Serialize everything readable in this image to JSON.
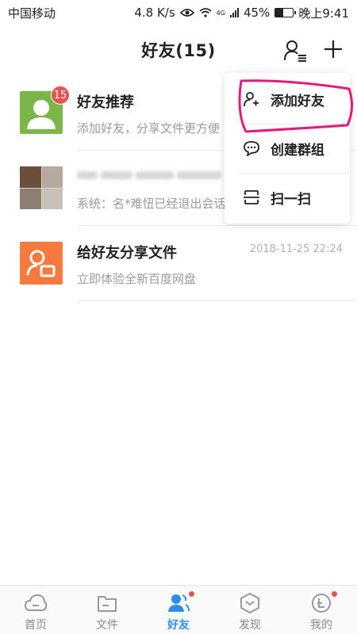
{
  "status_bar": {
    "carrier": "中国移动",
    "speed": "4.8 K/s",
    "network": "4G",
    "battery": "45%",
    "battery_level": 0.45,
    "time": "晚上9:41"
  },
  "header": {
    "title": "好友(15)",
    "contacts_icon": "contacts-list-icon",
    "add_icon": "plus-icon"
  },
  "list": [
    {
      "title": "好友推荐",
      "subtitle": "添加好友，分享文件更方便",
      "badge": "15",
      "time": ""
    },
    {
      "title": "",
      "subtitle": "系统：名*难忸已经退出会话",
      "time": ""
    },
    {
      "title": "给好友分享文件",
      "subtitle": "立即体验全新百度网盘",
      "time": "2018-11-25 22:24"
    }
  ],
  "popup_menu": {
    "items": [
      {
        "label": "添加好友",
        "icon": "add-user-icon"
      },
      {
        "label": "创建群组",
        "icon": "chat-bubble-icon"
      },
      {
        "label": "扫一扫",
        "icon": "scan-icon"
      }
    ],
    "highlight_color": "#e8197d"
  },
  "bottom_nav": {
    "items": [
      {
        "label": "首页",
        "icon": "cloud-home-icon"
      },
      {
        "label": "文件",
        "icon": "folder-icon"
      },
      {
        "label": "好友",
        "icon": "friends-icon"
      },
      {
        "label": "发现",
        "icon": "discover-hexagon-icon"
      },
      {
        "label": "我的",
        "icon": "profile-coin-icon"
      }
    ],
    "active": "好友",
    "accent": "#2d8ef2"
  }
}
